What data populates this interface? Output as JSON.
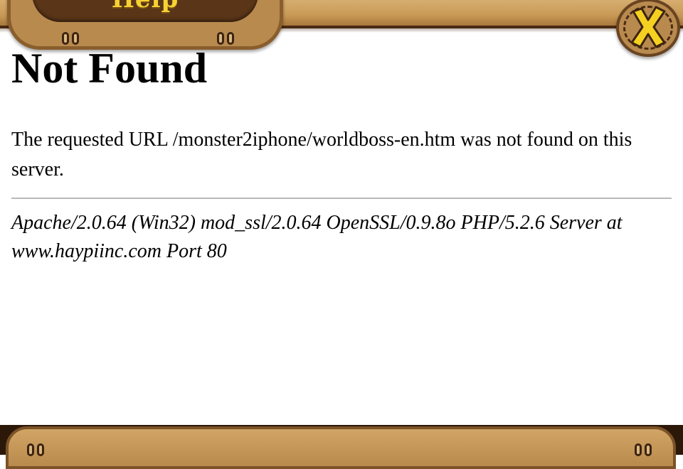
{
  "header": {
    "title": "Help",
    "close_icon": "close-icon"
  },
  "page": {
    "heading": "Not Found",
    "message": "The requested URL /monster2iphone/worldboss-en.htm was not found on this server.",
    "signature": "Apache/2.0.64 (Win32) mod_ssl/2.0.64 OpenSSL/0.9.8o PHP/5.2.6 Server at www.haypiinc.com Port 80"
  },
  "colors": {
    "wood": "#c89955",
    "wood_dark": "#5a3518",
    "title_yellow": "#f6d232",
    "close_yellow": "#f5d020"
  }
}
